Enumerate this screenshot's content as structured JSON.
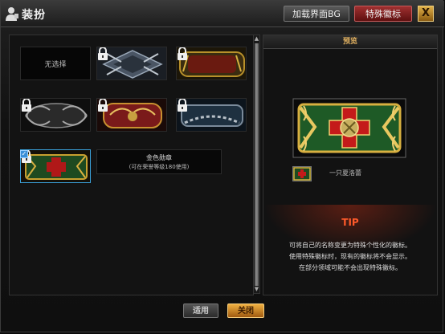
{
  "window": {
    "title": "装扮",
    "title_icon": "user-icon",
    "top_buttons": {
      "background_bg": "加载界面BG",
      "special_badge": "特殊徽标"
    },
    "close_label": "X"
  },
  "badge_grid": {
    "none_label": "无选择",
    "items": [
      {
        "name": "silver-eagle-badge",
        "locked": true,
        "color": "#5a6878"
      },
      {
        "name": "gold-trophy-badge",
        "locked": true,
        "color": "#6a5a20"
      },
      {
        "name": "dark-tribal-badge",
        "locked": true,
        "color": "#2a2a2a"
      },
      {
        "name": "red-winged-badge",
        "locked": true,
        "color": "#7a1a1a"
      },
      {
        "name": "steel-chain-badge",
        "locked": true,
        "color": "#1e3040"
      },
      {
        "name": "iron-cross-gold-badge",
        "locked": true,
        "selected": true,
        "color": "#1e4a20"
      }
    ],
    "selected_info": {
      "name": "金色勋章",
      "requirement": "(可在荣誉等级180使用)"
    }
  },
  "preview": {
    "header": "预览",
    "badge_name": "一只夏洛蕾",
    "tip_title": "TIP",
    "tip_lines": [
      "可将自己的名称变更为特殊个性化的徽标。",
      "使用特殊徽标时，现有的徽标将不会显示。",
      "在部分领域可能不会出现特殊徽标。"
    ]
  },
  "actions": {
    "apply": "适用",
    "close": "关闭"
  },
  "colors": {
    "accent_gold": "#e0b060",
    "tip_red": "#ff5a2a",
    "selection_blue": "#3a9fd8"
  }
}
